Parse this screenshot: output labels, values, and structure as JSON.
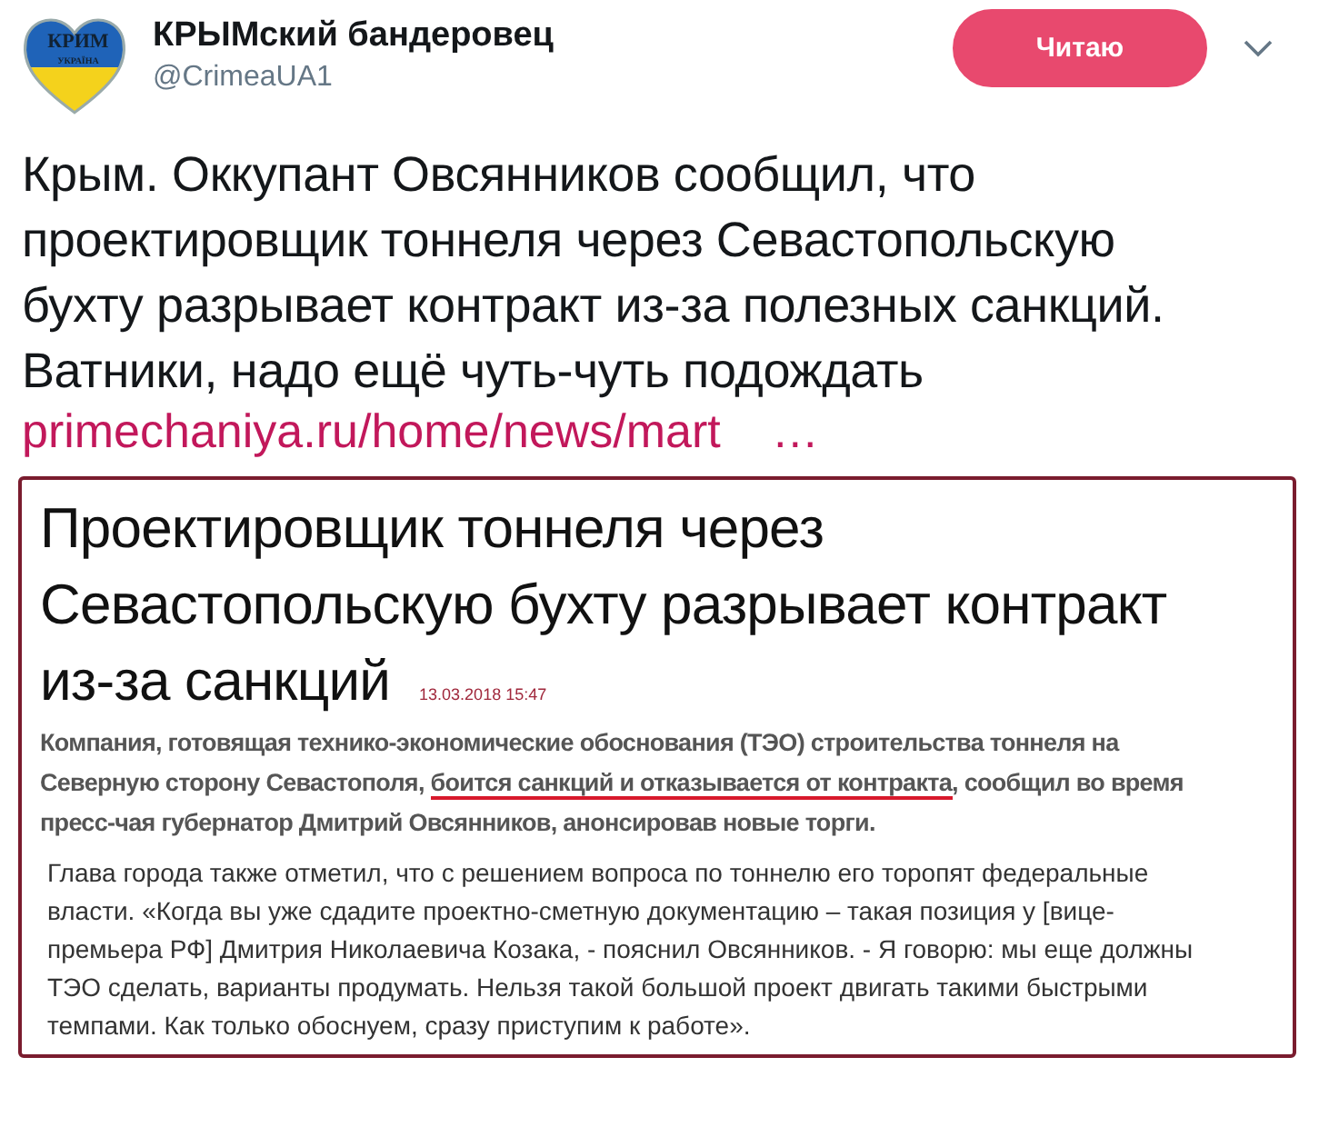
{
  "author": {
    "name": "КРЫМский бандеровец",
    "handle": "@CrimeaUA1",
    "avatar_text": "КРИМ",
    "avatar_subtext": "УКРАЇНА"
  },
  "follow_button": {
    "label": "Читаю",
    "following": true
  },
  "tweet_text": "Крым. Оккупант Овсянников сообщил, что проектировщик тоннеля через Севастопольскую бухту разрывает контракт из-за полезных санкций. Ватники, надо ещё чуть-чуть подождать",
  "link": {
    "text": "primechaniya.ru/home/news/mart",
    "ellipsis": "…"
  },
  "article": {
    "headline_lines": [
      "Проектировщик тоннеля через",
      "Севастопольскую бухту разрывает контракт",
      "из-за санкций"
    ],
    "date": "13.03.2018 15:47",
    "lead_lines": [
      [
        {
          "text": "Компания, готовящая технико-экономические обоснования (ТЭО) строительства тоннеля на",
          "underlined": false
        }
      ],
      [
        {
          "text": "Северную сторону Севастополя, ",
          "underlined": false
        },
        {
          "text": "боится санкций и отказывается от контракта",
          "underlined": true
        },
        {
          "text": ", сообщил во время",
          "underlined": false
        }
      ],
      [
        {
          "text": "пресс-чая губернатор Дмитрий Овсянников, анонсировав новые торги.",
          "underlined": false
        }
      ]
    ],
    "body_lines": [
      "Глава города также отметил, что с решением вопроса по тоннелю его торопят федеральные",
      "власти. «Когда вы уже сдадите проектно-сметную документацию – такая позиция у [вице-",
      "премьера РФ] Дмитрия Николаевича Козака, - пояснил Овсянников. - Я говорю: мы еще должны",
      "ТЭО сделать, варианты продумать. Нельзя такой большой проект двигать такими быстрыми",
      "темпами. Как только обоснуем, сразу приступим к работе»."
    ]
  }
}
